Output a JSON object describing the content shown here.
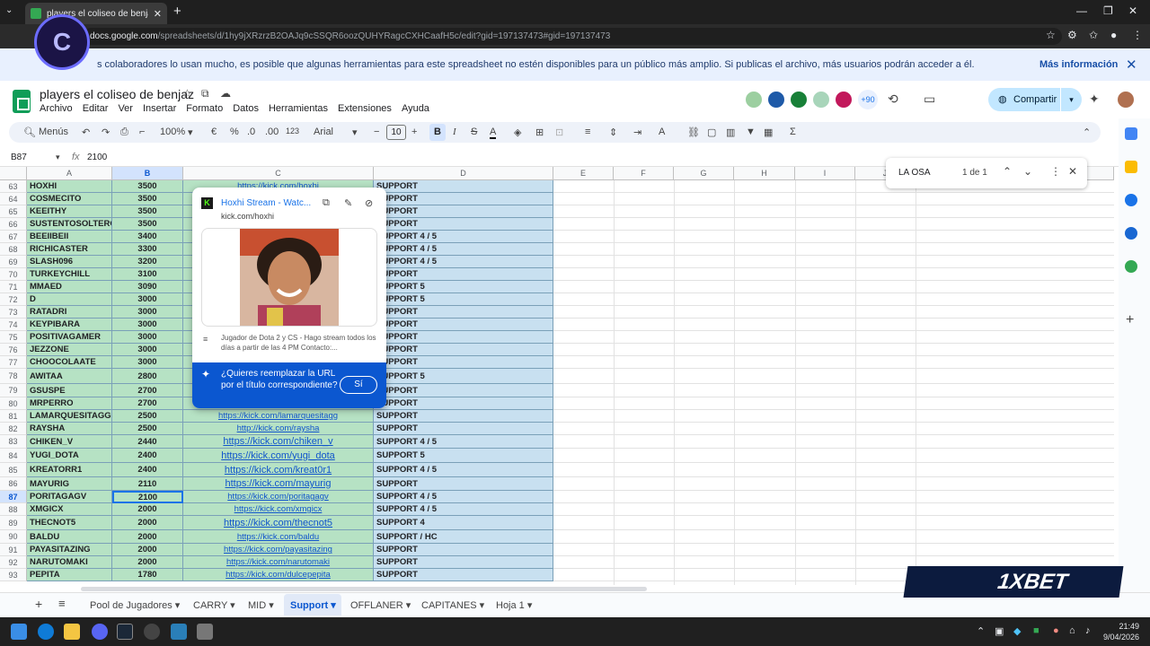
{
  "browser": {
    "tab_title": "players el coliseo de benjaz - Hoja",
    "url_host": "docs.google.com",
    "url_path": "/spreadsheets/d/1hy9jXRzrzB2OAJq9cSSQR6oozQUHYRagcCXHCaafH5c/edit?gid=197137473#gid=197137473"
  },
  "infobar": {
    "message": "s colaboradores lo usan mucho, es posible que algunas herramientas para este spreadsheet no estén disponibles para un público más amplio. Si publicas el archivo, más usuarios podrán acceder a él.",
    "more": "Más información"
  },
  "doc": {
    "title": "players el coliseo de benjaz",
    "menus": [
      "Archivo",
      "Editar",
      "Ver",
      "Insertar",
      "Formato",
      "Datos",
      "Herramientas",
      "Extensiones",
      "Ayuda"
    ],
    "avatar_count": "+90",
    "share": "Compartir"
  },
  "toolbar": {
    "menus": "Menús",
    "zoom": "100%",
    "currency": "€",
    "percent": "%",
    "dec_less": ".0",
    "dec_more": ".00",
    "num": "123",
    "font": "Arial",
    "fontsize": "10",
    "sigma": "Σ"
  },
  "formula": {
    "cell": "B87",
    "fx": "fx",
    "value": "2100"
  },
  "columns": [
    "A",
    "B",
    "C",
    "D",
    "E",
    "F",
    "G",
    "H",
    "I",
    "J"
  ],
  "rows": [
    {
      "n": "63",
      "a": "HOXHI",
      "b": "3500",
      "c": "https://kick.com/hoxhi",
      "d": "SUPPORT"
    },
    {
      "n": "64",
      "a": "COSMECITO",
      "b": "3500",
      "c": "",
      "d": "SUPPORT"
    },
    {
      "n": "65",
      "a": "KEEITHY",
      "b": "3500",
      "c": "",
      "d": "SUPPORT"
    },
    {
      "n": "66",
      "a": "SUSTENTOSOLTERO",
      "b": "3500",
      "c": "",
      "d": "SUPPORT"
    },
    {
      "n": "67",
      "a": "BEEIIBEII",
      "b": "3400",
      "c": "",
      "d": "SUPPORT 4 / 5"
    },
    {
      "n": "68",
      "a": "RICHICASTER",
      "b": "3300",
      "c": "",
      "d": "SUPPORT 4 / 5"
    },
    {
      "n": "69",
      "a": "SLASH096",
      "b": "3200",
      "c": "",
      "d": "SUPPORT 4 / 5"
    },
    {
      "n": "70",
      "a": "TURKEYCHILL",
      "b": "3100",
      "c": "",
      "d": "SUPPORT"
    },
    {
      "n": "71",
      "a": "MMAED",
      "b": "3090",
      "c": "",
      "d": "SUPPORT 5"
    },
    {
      "n": "72",
      "a": "D",
      "b": "3000",
      "c": "",
      "d": "SUPPORT 5"
    },
    {
      "n": "73",
      "a": "RATADRI",
      "b": "3000",
      "c": "",
      "d": "SUPPORT"
    },
    {
      "n": "74",
      "a": "KEYPIBARA",
      "b": "3000",
      "c": "",
      "d": "SUPPORT"
    },
    {
      "n": "75",
      "a": "POSITIVAGAMER",
      "b": "3000",
      "c": "",
      "d": "SUPPORT"
    },
    {
      "n": "76",
      "a": "JEZZONE",
      "b": "3000",
      "c": "",
      "d": "SUPPORT"
    },
    {
      "n": "77",
      "a": "CHOOCOLAATE",
      "b": "3000",
      "c": "",
      "d": "SUPPORT"
    },
    {
      "n": "78",
      "a": "AWITAA",
      "b": "2800",
      "c": "",
      "d": "SUPPORT 5"
    },
    {
      "n": "79",
      "a": "GSUSPE",
      "b": "2700",
      "c": "",
      "d": "SUPPORT"
    },
    {
      "n": "80",
      "a": "MRPERRO",
      "b": "2700",
      "c": "",
      "d": "SUPPORT"
    },
    {
      "n": "81",
      "a": "LAMARQUESITAGG",
      "b": "2500",
      "c": "https://kick.com/lamarquesitagg",
      "d": "SUPPORT"
    },
    {
      "n": "82",
      "a": "RAYSHA",
      "b": "2500",
      "c": "http://kick.com/raysha",
      "d": "SUPPORT"
    },
    {
      "n": "83",
      "a": "CHIKEN_V",
      "b": "2440",
      "c": "https://kick.com/chiken_v",
      "d": "SUPPORT 4 / 5"
    },
    {
      "n": "84",
      "a": "YUGI_DOTA",
      "b": "2400",
      "c": "https://kick.com/yugi_dota",
      "d": "SUPPORT 5"
    },
    {
      "n": "85",
      "a": "KREATORR1",
      "b": "2400",
      "c": "https://kick.com/kreat0r1",
      "d": "SUPPORT 4 / 5"
    },
    {
      "n": "86",
      "a": "MAYURIG",
      "b": "2110",
      "c": "https://kick.com/mayurig",
      "d": "SUPPORT"
    },
    {
      "n": "87",
      "a": "PORITAGAGV",
      "b": "2100",
      "c": "https://kick.com/poritagagv",
      "d": "SUPPORT 4 / 5"
    },
    {
      "n": "88",
      "a": "XMGICX",
      "b": "2000",
      "c": "https://kick.com/xmgicx",
      "d": "SUPPORT 4 / 5"
    },
    {
      "n": "89",
      "a": "THECNOT5",
      "b": "2000",
      "c": "https://kick.com/thecnot5",
      "d": "SUPPORT 4"
    },
    {
      "n": "90",
      "a": "BALDU",
      "b": "2000",
      "c": "https://kick.com/baldu",
      "d": "SUPPORT / HC"
    },
    {
      "n": "91",
      "a": "PAYASITAZING",
      "b": "2000",
      "c": "https://kick.com/payasitazing",
      "d": "SUPPORT"
    },
    {
      "n": "92",
      "a": "NARUTOMAKI",
      "b": "2000",
      "c": "https://kick.com/narutomaki",
      "d": "SUPPORT"
    },
    {
      "n": "93",
      "a": "PEPITA",
      "b": "1780",
      "c": "https://kick.com/dulcepepita",
      "d": "SUPPORT"
    }
  ],
  "find": {
    "query": "LA OSA",
    "count": "1 de 1"
  },
  "popup": {
    "title": "Hoxhi Stream - Watc...",
    "url": "kick.com/hoxhi",
    "description": "Jugador de Dota 2 y CS - Hago stream todos los días a partir de las 4 PM Contacto:...",
    "suggest": "¿Quieres reemplazar la URL por el título correspondiente?",
    "yes": "Sí"
  },
  "sheets": [
    "Pool de Jugadores",
    "CARRY",
    "MID",
    "Support",
    "OFFLANER",
    "CAPITANES",
    "Hoja 1"
  ],
  "overlay": {
    "logo_text": "1XBET"
  },
  "clock": {
    "time": "21:49",
    "date": "9/04/2026"
  }
}
